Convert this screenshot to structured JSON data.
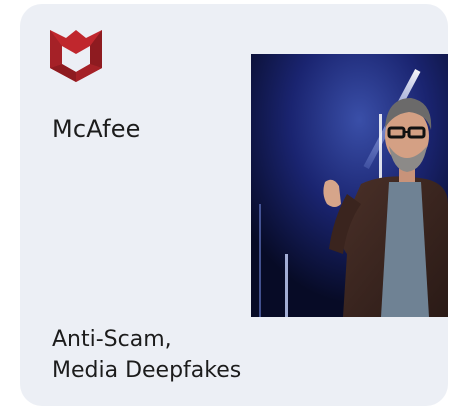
{
  "card": {
    "brand": {
      "name": "McAfee",
      "logo_icon": "mcafee-shield-logo",
      "logo_color": "#c0272d"
    },
    "media": {
      "icon": "stage-speaker-image"
    },
    "tags": [
      "Anti-Scam,",
      "Media Deepfakes"
    ]
  }
}
